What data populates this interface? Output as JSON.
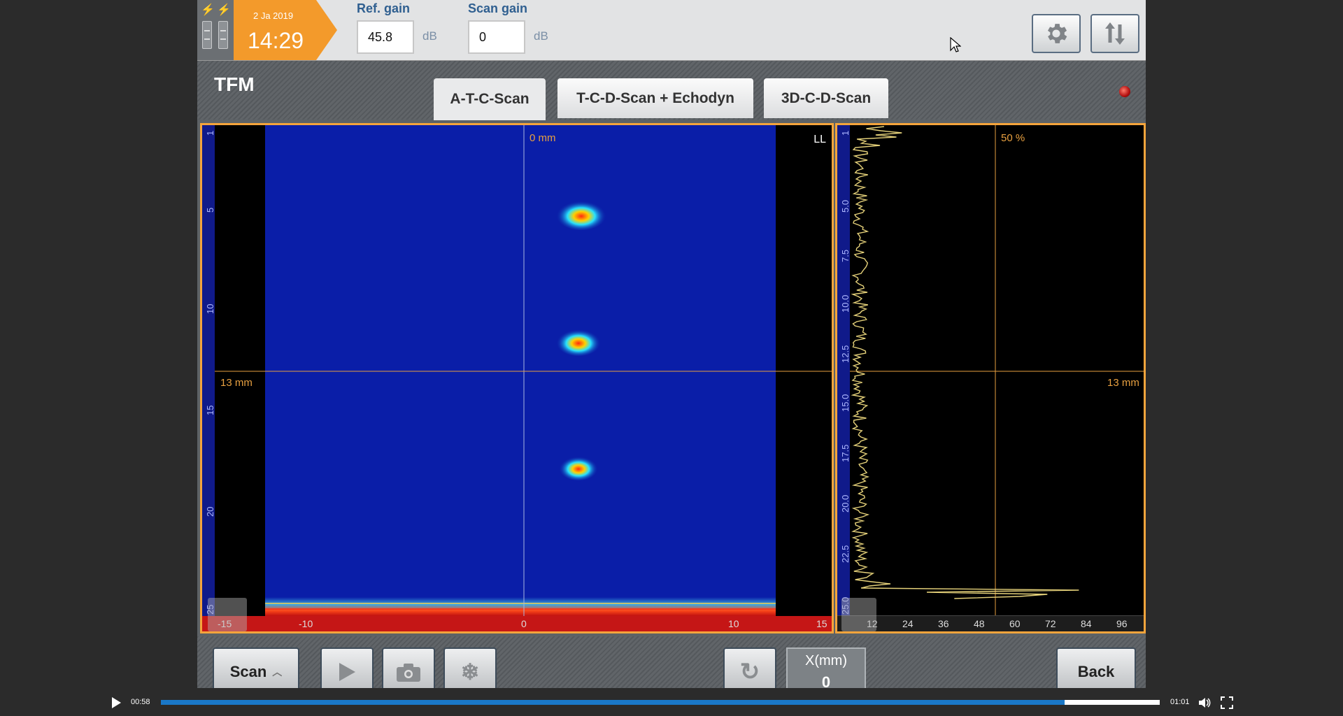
{
  "status": {
    "date": "2 Ja 2019",
    "time": "14:29"
  },
  "ref_gain": {
    "label": "Ref. gain",
    "value": "45.8",
    "unit": "dB"
  },
  "scan_gain": {
    "label": "Scan gain",
    "value": "0",
    "unit": "dB"
  },
  "header": {
    "title": "TFM"
  },
  "tabs": [
    {
      "label": "A-T-C-Scan",
      "active": true
    },
    {
      "label": "T-C-D-Scan + Echodyn",
      "active": false
    },
    {
      "label": "3D-C-D-Scan",
      "active": false
    }
  ],
  "cscan": {
    "x_cursor_label": "0 mm",
    "y_cursor_label": "13 mm",
    "mode_label": "LL",
    "y_ticks": [
      "1",
      "5",
      "10",
      "15",
      "20",
      "25"
    ],
    "x_ticks": [
      "-15",
      "-10",
      "0",
      "10",
      "15"
    ]
  },
  "ascan": {
    "amplitude_label": "50 %",
    "depth_label": "13 mm",
    "y_ticks": [
      "1",
      "5.0",
      "7.5",
      "10.0",
      "12.5",
      "15.0",
      "17.5",
      "20.0",
      "22.5",
      "25.0"
    ],
    "x_ticks": [
      "12",
      "24",
      "36",
      "48",
      "60",
      "72",
      "84",
      "96"
    ]
  },
  "bottom": {
    "scan_label": "Scan",
    "x_label": "X(mm)",
    "x_value": "0",
    "back_label": "Back"
  },
  "video": {
    "elapsed": "00:58",
    "duration": "01:01",
    "progress": 0.905
  },
  "colors": {
    "accent": "#f39a2b",
    "scan_bg": "#0a1ea8",
    "cursor": "#e8a040"
  }
}
